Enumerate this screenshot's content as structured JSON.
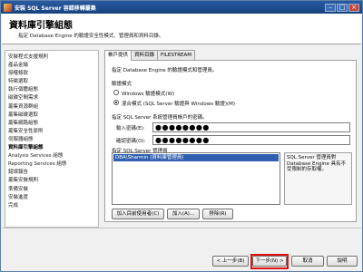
{
  "window": {
    "title": "安裝 SQL Server 容錯移轉叢集",
    "controls": [
      "minimize",
      "maximize",
      "close"
    ]
  },
  "header": {
    "title": "資料庫引擎組態",
    "subtitle": "指定 Database Engine 的驗證安全性模式、管理員和資料目錄。"
  },
  "sidebar": {
    "items": [
      "安裝程式支援規則",
      "產品金鑰",
      "授權條款",
      "特徵選取",
      "執行個體組態",
      "磁碟空間需求",
      "叢集資源群組",
      "叢集磁碟選取",
      "叢集網路組態",
      "叢集安全性原則",
      "伺服器組態",
      "資料庫引擎組態",
      "Analysis Services 組態",
      "Reporting Services 組態",
      "錯誤報告",
      "叢集安裝規則",
      "準備安裝",
      "安裝進度",
      "完成"
    ],
    "active_index": 11
  },
  "tabs": [
    "帳戶提供",
    "資料目錄",
    "FILESTREAM"
  ],
  "panel": {
    "intro": "指定 Database Engine 的驗證模式和管理員。",
    "auth_mode_label": "驗證模式",
    "windows_auth_label": "Windows 驗證模式(W)",
    "mixed_auth_label": "混合模式 (SQL Server 驗證與 Windows 驗證)(M)",
    "sa_password_label": "指定 SQL Server 系統管理員帳戶的密碼。",
    "enter_password_label": "輸入密碼(E):",
    "confirm_password_label": "確認密碼(O):",
    "enter_password_value": "●●●●●●●●",
    "confirm_password_value": "●●●●●●●●",
    "admins_label": "指定 SQL Server 管理員",
    "admin_entry": "DBA\\Sharmin (資料庫管理員)",
    "admins_help": "SQL Server 管理員對 Database Engine 具有不受限制的存取權。",
    "add_current_user_button": "加入目前使用者(C)",
    "add_button": "加入(A)...",
    "remove_button": "移除(R)"
  },
  "footer": {
    "back_button": "< 上一步(B)",
    "next_button": "下一步(N) >",
    "cancel_button": "取消",
    "help_button": "說明"
  },
  "colors": {
    "title_bar": "#16437f",
    "selection": "#2f5fb0",
    "highlight_border": "#e01010"
  }
}
